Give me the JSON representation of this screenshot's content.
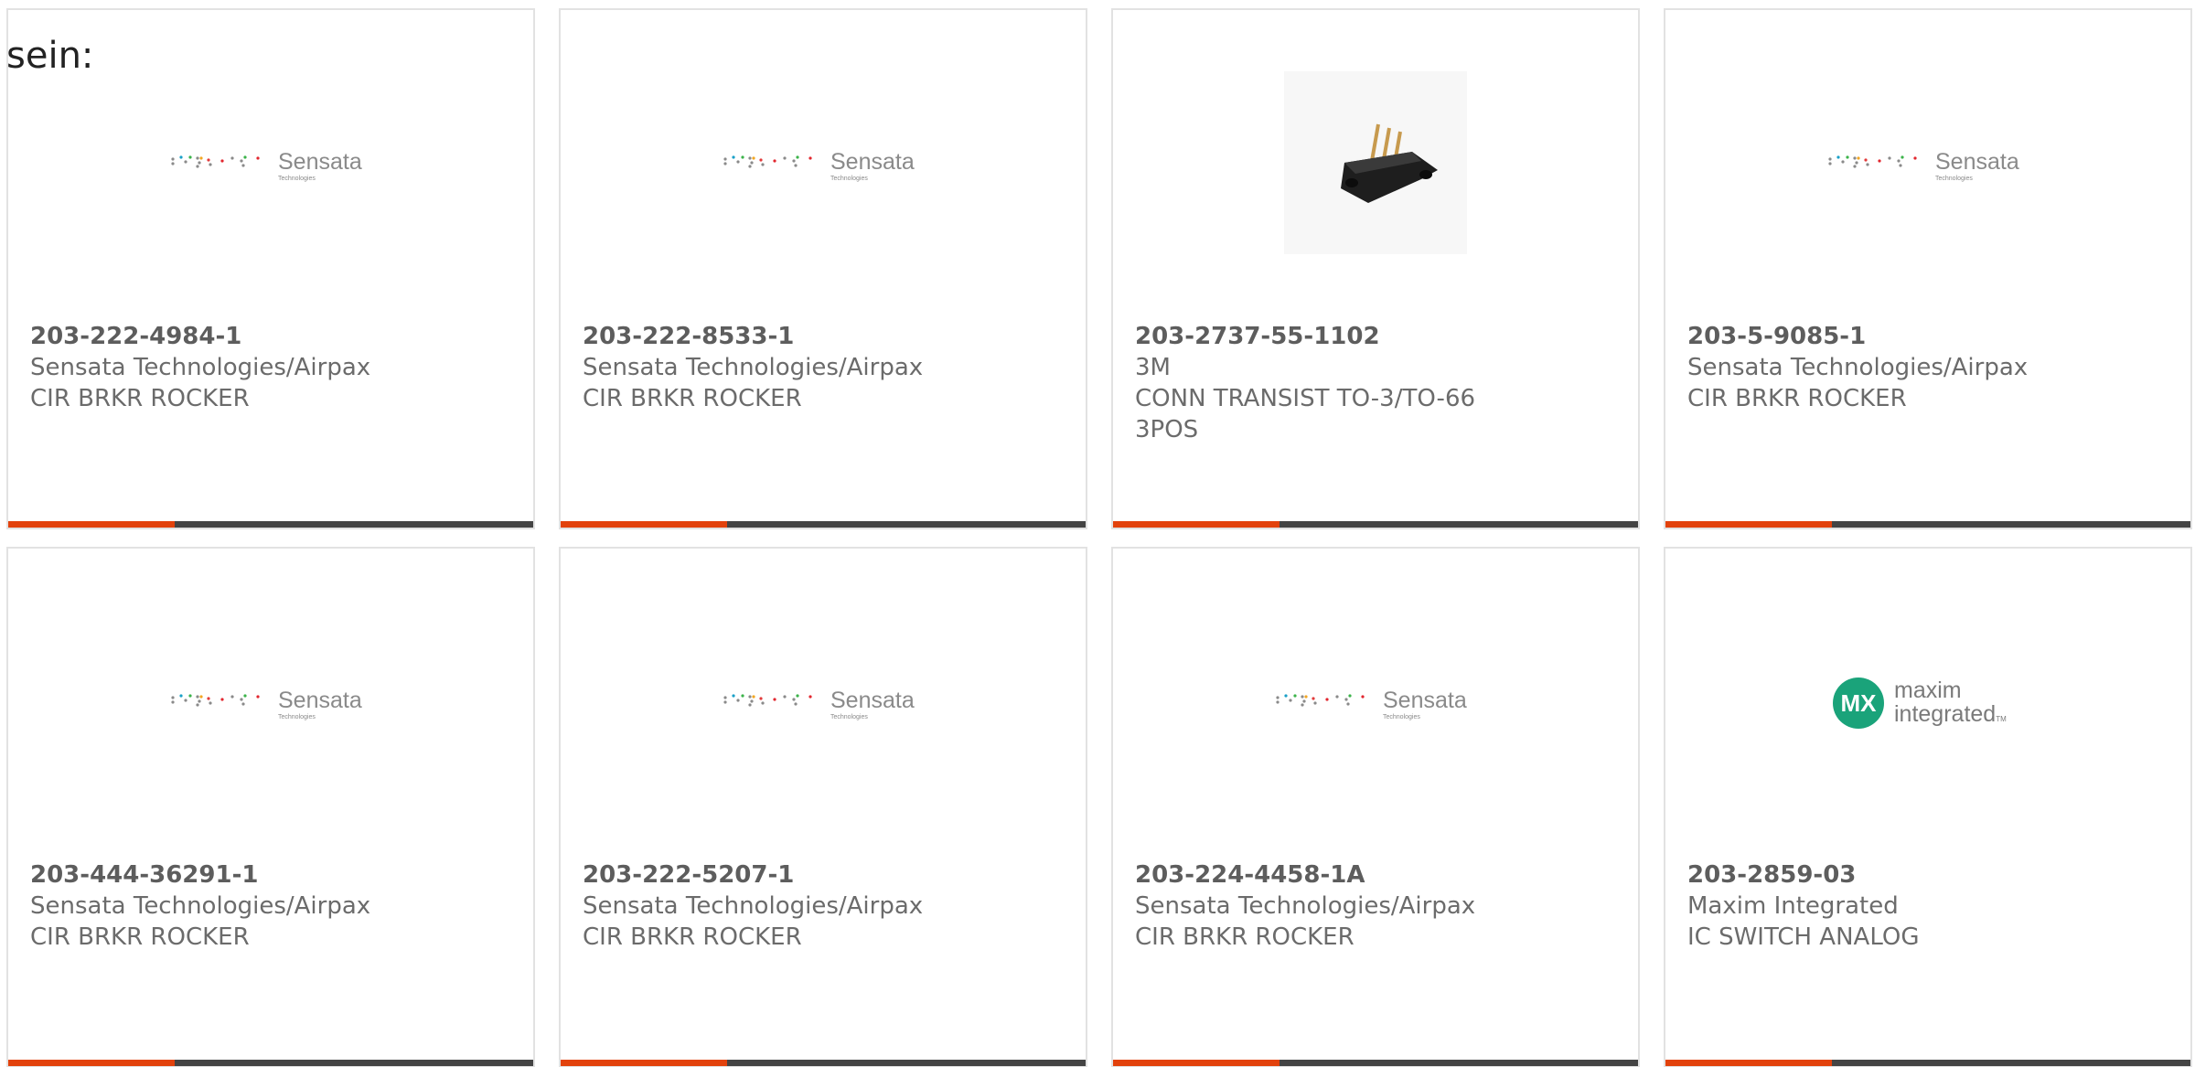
{
  "intro": {
    "text": "sein:"
  },
  "logos": {
    "sensata": {
      "name": "Sensata",
      "sub": "Technologies"
    },
    "maxim": {
      "line1": "maxim",
      "line2": "integrated",
      "tm": "TM",
      "mark": "MX"
    }
  },
  "colors": {
    "accent": "#e2420c",
    "bar": "#444444",
    "border": "#e2e2e2",
    "maxim_teal": "#1aa37a"
  },
  "products": [
    {
      "part_number": "203-222-4984-1",
      "manufacturer": "Sensata Technologies/Airpax",
      "description": "CIR BRKR ROCKER",
      "image": "sensata-logo"
    },
    {
      "part_number": "203-222-8533-1",
      "manufacturer": "Sensata Technologies/Airpax",
      "description": "CIR BRKR ROCKER",
      "image": "sensata-logo"
    },
    {
      "part_number": "203-2737-55-1102",
      "manufacturer": "3M",
      "description": "CONN TRANSIST TO-3/TO-66 3POS",
      "image": "connector-photo"
    },
    {
      "part_number": "203-5-9085-1",
      "manufacturer": "Sensata Technologies/Airpax",
      "description": "CIR BRKR ROCKER",
      "image": "sensata-logo"
    },
    {
      "part_number": "203-444-36291-1",
      "manufacturer": "Sensata Technologies/Airpax",
      "description": "CIR BRKR ROCKER",
      "image": "sensata-logo"
    },
    {
      "part_number": "203-222-5207-1",
      "manufacturer": "Sensata Technologies/Airpax",
      "description": "CIR BRKR ROCKER",
      "image": "sensata-logo"
    },
    {
      "part_number": "203-224-4458-1A",
      "manufacturer": "Sensata Technologies/Airpax",
      "description": "CIR BRKR ROCKER",
      "image": "sensata-logo"
    },
    {
      "part_number": "203-2859-03",
      "manufacturer": "Maxim Integrated",
      "description": "IC SWITCH ANALOG",
      "image": "maxim-logo"
    }
  ]
}
